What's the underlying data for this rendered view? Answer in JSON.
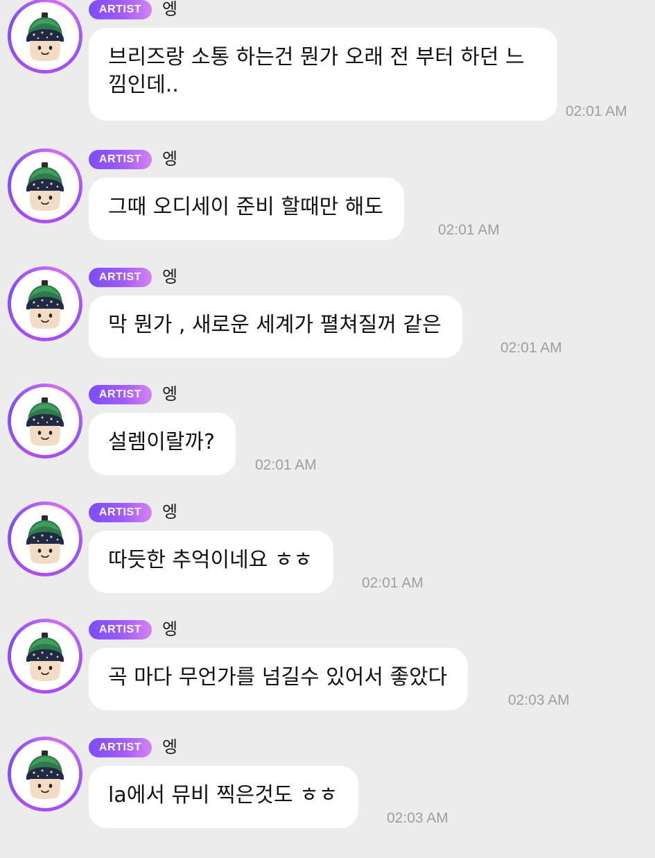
{
  "colors": {
    "background": "#ececec",
    "bubble": "#ffffff",
    "badge_start": "#7b4dff",
    "badge_end": "#d583f5",
    "timestamp": "#9e9e9e"
  },
  "messages": [
    {
      "badge": "ARTIST",
      "sender": "엥",
      "text": "브리즈랑 소통 하는건 뭔가 오래 전 부터 하던 느낌인데..",
      "time": "02:01 AM",
      "avatar_icon": "green-beanie-plush-avatar-icon"
    },
    {
      "badge": "ARTIST",
      "sender": "엥",
      "text": "그때 오디세이 준비 할때만 해도",
      "time": "02:01 AM",
      "avatar_icon": "green-beanie-plush-avatar-icon"
    },
    {
      "badge": "ARTIST",
      "sender": "엥",
      "text": "막 뭔가 , 새로운 세계가 펼쳐질꺼 같은",
      "time": "02:01 AM",
      "avatar_icon": "green-beanie-plush-avatar-icon"
    },
    {
      "badge": "ARTIST",
      "sender": "엥",
      "text": "설렘이랄까?",
      "time": "02:01 AM",
      "avatar_icon": "green-beanie-plush-avatar-icon"
    },
    {
      "badge": "ARTIST",
      "sender": "엥",
      "text": "따듯한 추억이네요 ㅎㅎ",
      "time": "02:01 AM",
      "avatar_icon": "green-beanie-plush-avatar-icon"
    },
    {
      "badge": "ARTIST",
      "sender": "엥",
      "text": "곡 마다 무언가를 넘길수 있어서 좋았다",
      "time": "02:03 AM",
      "avatar_icon": "green-beanie-plush-avatar-icon"
    },
    {
      "badge": "ARTIST",
      "sender": "엥",
      "text": "la에서 뮤비 찍은것도 ㅎㅎ",
      "time": "02:03 AM",
      "avatar_icon": "green-beanie-plush-avatar-icon"
    }
  ]
}
